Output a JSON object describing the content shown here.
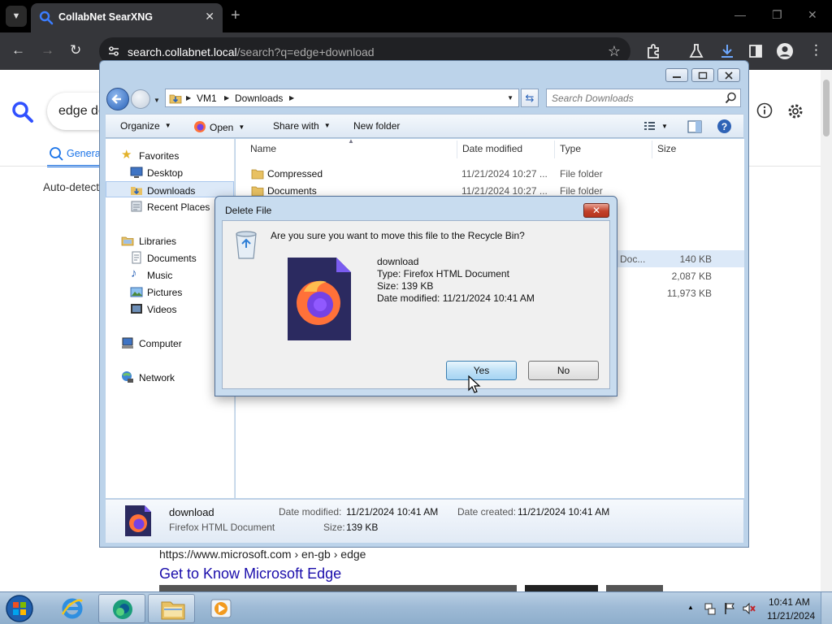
{
  "browser": {
    "tab_title": "CollabNet SearXNG",
    "new_tab": "+",
    "url_host": "search.collabnet.local",
    "url_path": "/search?q=edge+download"
  },
  "webpage": {
    "search_query": "edge do",
    "category_general": "Genera",
    "auto_detect": "Auto-detect",
    "result_url": "https://www.microsoft.com  › en-gb › edge",
    "result_title": "Get to Know Microsoft Edge"
  },
  "explorer": {
    "breadcrumb": [
      "VM1",
      "Downloads"
    ],
    "search_placeholder": "Search Downloads",
    "toolbar": {
      "organize": "Organize",
      "open": "Open",
      "share_with": "Share with",
      "new_folder": "New folder"
    },
    "nav": {
      "favorites": "Favorites",
      "desktop": "Desktop",
      "downloads": "Downloads",
      "recent_places": "Recent Places",
      "libraries": "Libraries",
      "documents": "Documents",
      "music": "Music",
      "pictures": "Pictures",
      "videos": "Videos",
      "computer": "Computer",
      "network": "Network"
    },
    "columns": {
      "name": "Name",
      "date_modified": "Date modified",
      "type": "Type",
      "size": "Size"
    },
    "files": [
      {
        "name": "Compressed",
        "date": "11/21/2024 10:27 ...",
        "type": "File folder",
        "size": ""
      },
      {
        "name": "Documents",
        "date": "11/21/2024 10:27 ...",
        "type": "File folder",
        "size": ""
      },
      {
        "name": "",
        "date": "",
        "type": "Doc...",
        "size": "140 KB"
      },
      {
        "name": "",
        "date": "",
        "type": "",
        "size": "2,087 KB"
      },
      {
        "name": "",
        "date": "",
        "type": "",
        "size": "11,973 KB"
      }
    ],
    "details": {
      "name": "download",
      "type": "Firefox HTML Document",
      "date_modified_label": "Date modified:",
      "date_modified": "11/21/2024 10:41 AM",
      "date_created_label": "Date created:",
      "date_created": "11/21/2024 10:41 AM",
      "size_label": "Size:",
      "size": "139 KB"
    }
  },
  "dialog": {
    "title": "Delete File",
    "question": "Are you sure you want to move this file to the Recycle Bin?",
    "file_name": "download",
    "file_type": "Type: Firefox HTML Document",
    "file_size": "Size: 139 KB",
    "file_date": "Date modified: 11/21/2024 10:41 AM",
    "yes": "Yes",
    "no": "No",
    "close": "✕"
  },
  "taskbar": {
    "time": "10:41 AM",
    "date": "11/21/2024"
  },
  "colors": {
    "chrome_dark": "#35363a",
    "link_blue": "#1a0dab",
    "accent_blue": "#1a73e8",
    "aero_frame": "#bcd3ea"
  }
}
